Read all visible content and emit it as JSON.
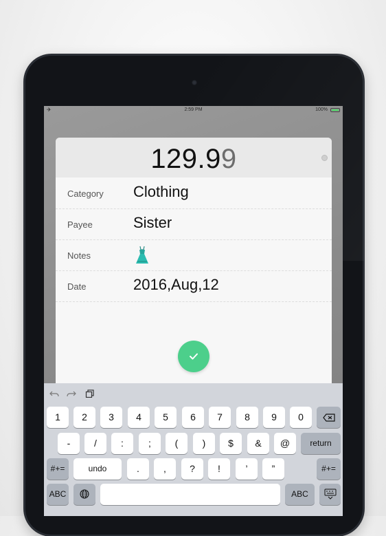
{
  "status_bar": {
    "time": "2:59 PM",
    "battery": "100%"
  },
  "entry": {
    "amount_main": "129.9",
    "amount_cursor": "9"
  },
  "fields": [
    {
      "label": "Category",
      "value": "Clothing"
    },
    {
      "label": "Payee",
      "value": "Sister"
    },
    {
      "label": "Notes",
      "value": ""
    },
    {
      "label": "Date",
      "value": "2016,Aug,12"
    }
  ],
  "keyboard": {
    "row1": [
      "1",
      "2",
      "3",
      "4",
      "5",
      "6",
      "7",
      "8",
      "9",
      "0"
    ],
    "row2": [
      "-",
      "/",
      ":",
      ";",
      "(",
      ")",
      "$",
      "&",
      "@"
    ],
    "return_label": "return",
    "row3_left": "#+=",
    "undo_label": "undo",
    "row3": [
      ".",
      ",",
      "?",
      "!",
      "’",
      "”"
    ],
    "row3_right": "#+=",
    "abc_left": "ABC",
    "abc_right": "ABC"
  },
  "icons": [
    "airplane-icon",
    "undo-icon",
    "redo-icon",
    "paste-icon",
    "delete-icon",
    "globe-icon",
    "keyboard-dismiss-icon",
    "dress-icon",
    "check-icon"
  ],
  "colors": {
    "confirm": "#4ccf8b",
    "battery": "#4cd964"
  }
}
